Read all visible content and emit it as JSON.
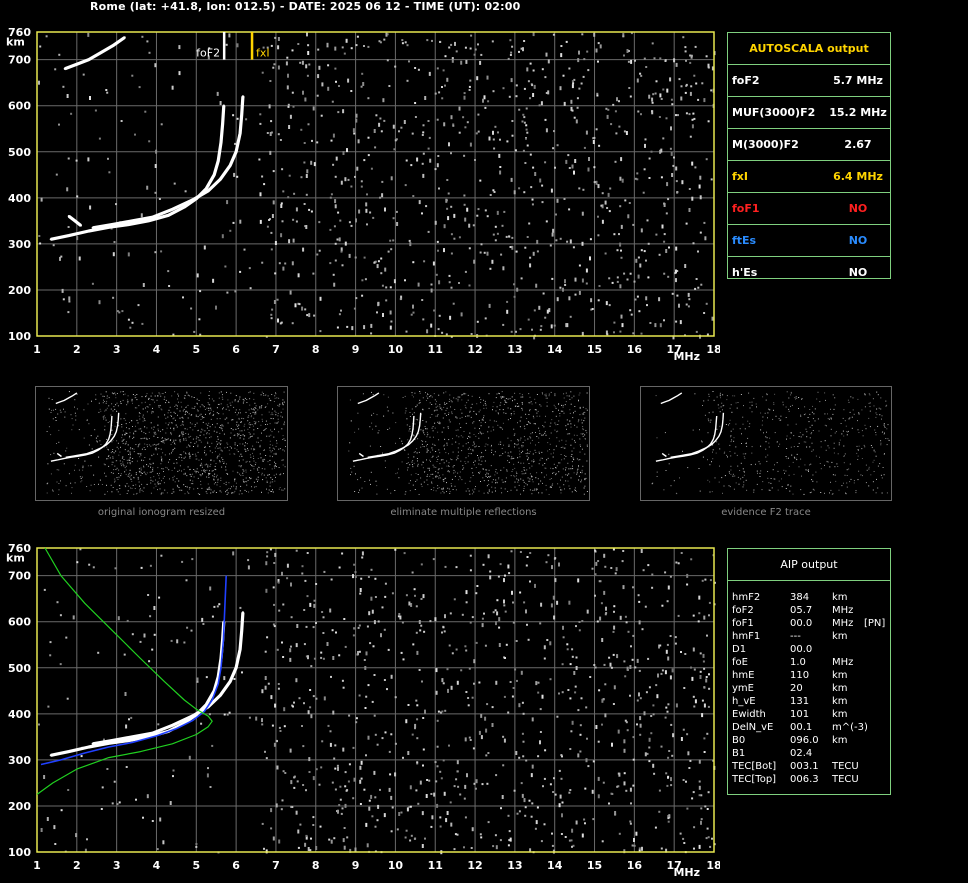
{
  "header": {
    "text": "Rome (lat: +41.8, lon: 012.5) - DATE: 2025 06 12 - TIME (UT): 02:00"
  },
  "autoscala": {
    "title": "AUTOSCALA output",
    "rows": [
      {
        "param": "foF2",
        "value": "5.7 MHz",
        "color": "#ffffff"
      },
      {
        "param": "MUF(3000)F2",
        "value": "15.2 MHz",
        "color": "#ffffff"
      },
      {
        "param": "M(3000)F2",
        "value": "2.67",
        "color": "#ffffff"
      },
      {
        "param": "fxI",
        "value": "6.4 MHz",
        "color": "#ffd400"
      },
      {
        "param": "foF1",
        "value": "NO",
        "color": "#ff2020"
      },
      {
        "param": "ftEs",
        "value": "NO",
        "color": "#2a8cff"
      },
      {
        "param": "h'Es",
        "value": "NO",
        "color": "#ffffff"
      }
    ]
  },
  "aip": {
    "title": "AIP output",
    "rows": [
      {
        "param": "hmF2",
        "value": "384",
        "unit": "km",
        "extra": ""
      },
      {
        "param": "foF2",
        "value": "05.7",
        "unit": "MHz",
        "extra": ""
      },
      {
        "param": "foF1",
        "value": "00.0",
        "unit": "MHz",
        "extra": "[PN]"
      },
      {
        "param": "hmF1",
        "value": "---",
        "unit": "km",
        "extra": ""
      },
      {
        "param": "D1",
        "value": "00.0",
        "unit": "",
        "extra": ""
      },
      {
        "param": "foE",
        "value": "1.0",
        "unit": "MHz",
        "extra": ""
      },
      {
        "param": "hmE",
        "value": "110",
        "unit": "km",
        "extra": ""
      },
      {
        "param": "ymE",
        "value": "20",
        "unit": "km",
        "extra": ""
      },
      {
        "param": "h_vE",
        "value": "131",
        "unit": "km",
        "extra": ""
      },
      {
        "param": "Ewidth",
        "value": "101",
        "unit": "km",
        "extra": ""
      },
      {
        "param": "DelN_vE",
        "value": "00.1",
        "unit": "m^(-3)",
        "extra": ""
      },
      {
        "param": "B0",
        "value": "096.0",
        "unit": "km",
        "extra": ""
      },
      {
        "param": "B1",
        "value": "02.4",
        "unit": "",
        "extra": ""
      },
      {
        "param": "TEC[Bot]",
        "value": "003.1",
        "unit": "TECU",
        "extra": ""
      },
      {
        "param": "TEC[Top]",
        "value": "006.3",
        "unit": "TECU",
        "extra": ""
      }
    ]
  },
  "captions": {
    "thumb1": "original ionogram resized",
    "thumb2": "eliminate multiple reflections",
    "thumb3": "evidence F2 trace"
  },
  "chart_data": [
    {
      "type": "scatter",
      "title": "",
      "xlabel": "MHz",
      "ylabel": "km",
      "xlim": [
        1,
        18
      ],
      "ylim": [
        100,
        760
      ],
      "x_ticks": [
        "1",
        "2",
        "3",
        "4",
        "5",
        "6",
        "7",
        "8",
        "9",
        "10",
        "11",
        "12",
        "13",
        "14",
        "15",
        "16",
        "17",
        "18"
      ],
      "y_ticks": [
        "100",
        "200",
        "300",
        "400",
        "500",
        "600",
        "700",
        "760"
      ],
      "grid": true,
      "markers": [
        {
          "name": "foF2",
          "x": 5.7,
          "color": "#ffffff"
        },
        {
          "name": "fxI",
          "x": 6.4,
          "color": "#ffd400"
        }
      ],
      "series": [
        {
          "color": "#ffffff",
          "points": [
            [
              1.35,
              310
            ],
            [
              1.8,
              318
            ],
            [
              2.3,
              328
            ],
            [
              2.8,
              336
            ],
            [
              3.3,
              342
            ],
            [
              3.8,
              350
            ],
            [
              4.3,
              362
            ],
            [
              4.7,
              380
            ],
            [
              5.0,
              398
            ],
            [
              5.25,
              420
            ],
            [
              5.45,
              450
            ],
            [
              5.55,
              480
            ],
            [
              5.62,
              520
            ],
            [
              5.66,
              560
            ],
            [
              5.69,
              600
            ]
          ]
        },
        {
          "color": "#ffffff",
          "points": [
            [
              2.4,
              335
            ],
            [
              2.9,
              342
            ],
            [
              3.4,
              350
            ],
            [
              3.9,
              358
            ],
            [
              4.4,
              375
            ],
            [
              4.9,
              395
            ],
            [
              5.3,
              415
            ],
            [
              5.6,
              440
            ],
            [
              5.85,
              470
            ],
            [
              6.0,
              500
            ],
            [
              6.1,
              540
            ],
            [
              6.14,
              580
            ],
            [
              6.17,
              620
            ]
          ]
        },
        {
          "color": "#ffffff",
          "points": [
            [
              1.8,
              360
            ],
            [
              1.95,
              350
            ],
            [
              2.1,
              340
            ]
          ]
        },
        {
          "color": "#ffffff",
          "points": [
            [
              1.7,
              680
            ],
            [
              2.0,
              690
            ],
            [
              2.3,
              700
            ],
            [
              2.6,
              715
            ],
            [
              2.9,
              730
            ],
            [
              3.2,
              748
            ]
          ]
        }
      ]
    },
    {
      "type": "line",
      "title": "",
      "xlabel": "MHz",
      "ylabel": "km",
      "xlim": [
        1,
        18
      ],
      "ylim": [
        100,
        760
      ],
      "x_ticks": [
        "1",
        "2",
        "3",
        "4",
        "5",
        "6",
        "7",
        "8",
        "9",
        "10",
        "11",
        "12",
        "13",
        "14",
        "15",
        "16",
        "17",
        "18"
      ],
      "y_ticks": [
        "100",
        "200",
        "300",
        "400",
        "500",
        "600",
        "700",
        "760"
      ],
      "grid": true,
      "series": [
        {
          "color": "#ffffff",
          "points": [
            [
              1.35,
              310
            ],
            [
              1.8,
              318
            ],
            [
              2.3,
              328
            ],
            [
              2.8,
              336
            ],
            [
              3.3,
              342
            ],
            [
              3.8,
              350
            ],
            [
              4.3,
              362
            ],
            [
              4.7,
              380
            ],
            [
              5.0,
              398
            ],
            [
              5.25,
              420
            ],
            [
              5.45,
              450
            ],
            [
              5.55,
              480
            ],
            [
              5.62,
              520
            ],
            [
              5.66,
              560
            ],
            [
              5.69,
              600
            ]
          ]
        },
        {
          "color": "#ffffff",
          "points": [
            [
              2.4,
              335
            ],
            [
              2.9,
              342
            ],
            [
              3.4,
              350
            ],
            [
              3.9,
              358
            ],
            [
              4.4,
              375
            ],
            [
              4.9,
              395
            ],
            [
              5.3,
              415
            ],
            [
              5.6,
              440
            ],
            [
              5.85,
              470
            ],
            [
              6.0,
              500
            ],
            [
              6.1,
              540
            ],
            [
              6.14,
              580
            ],
            [
              6.17,
              620
            ]
          ]
        },
        {
          "color": "#2040ff",
          "points": [
            [
              1.1,
              290
            ],
            [
              1.6,
              300
            ],
            [
              2.2,
              315
            ],
            [
              2.8,
              328
            ],
            [
              3.4,
              338
            ],
            [
              4.0,
              352
            ],
            [
              4.5,
              368
            ],
            [
              4.9,
              385
            ],
            [
              5.2,
              405
            ],
            [
              5.4,
              430
            ],
            [
              5.55,
              465
            ],
            [
              5.62,
              500
            ],
            [
              5.68,
              560
            ],
            [
              5.72,
              640
            ],
            [
              5.75,
              700
            ]
          ]
        },
        {
          "color": "#20d020",
          "points": [
            [
              1.2,
              760
            ],
            [
              1.6,
              700
            ],
            [
              2.2,
              640
            ],
            [
              2.9,
              580
            ],
            [
              3.6,
              520
            ],
            [
              4.2,
              470
            ],
            [
              4.7,
              430
            ],
            [
              5.0,
              410
            ],
            [
              5.3,
              395
            ],
            [
              5.4,
              384
            ],
            [
              5.3,
              372
            ],
            [
              5.0,
              355
            ],
            [
              4.4,
              335
            ],
            [
              3.6,
              318
            ],
            [
              2.8,
              305
            ],
            [
              2.0,
              280
            ],
            [
              1.4,
              250
            ],
            [
              1.0,
              225
            ]
          ]
        }
      ]
    }
  ]
}
